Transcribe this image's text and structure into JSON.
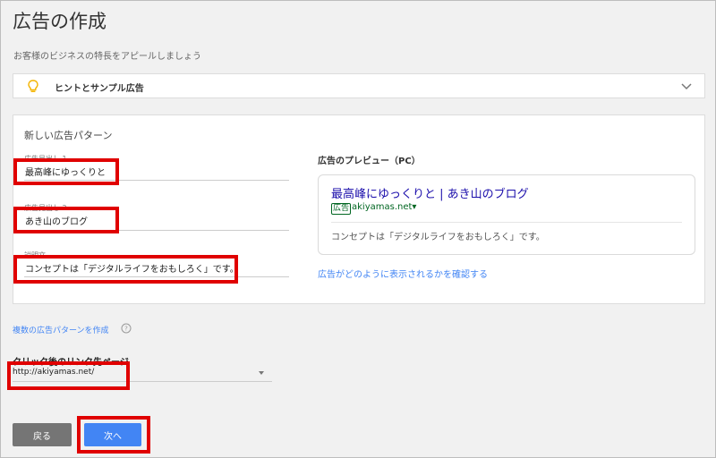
{
  "page": {
    "title": "広告の作成",
    "subtitle": "お客様のビジネスの特長をアピールしましょう"
  },
  "hints": {
    "label": "ヒントとサンプル広告",
    "icon": "lightbulb-icon",
    "toggle_icon": "chevron-down-icon"
  },
  "pattern": {
    "title": "新しい広告パターン",
    "headline1": {
      "label": "広告見出し 1",
      "value": "最高峰にゆっくりと"
    },
    "headline2": {
      "label": "広告見出し 2",
      "value": "あき山のブログ"
    },
    "description": {
      "label": "説明文",
      "value": "コンセプトは「デジタルライフをおもしろく」です。"
    }
  },
  "preview": {
    "title": "広告のプレビュー（PC）",
    "headline": "最高峰にゆっくりと | あき山のブログ",
    "ad_badge": "広告",
    "url": "akiyamas.net",
    "url_dropdown_icon": "▾",
    "description": "コンセプトは「デジタルライフをおもしろく」です。",
    "link": "広告がどのように表示されるかを確認する"
  },
  "multi_pattern": {
    "link": "複数の広告パターンを作成",
    "help_icon": "help-circle-icon"
  },
  "landing": {
    "label": "クリック後のリンク先ページ",
    "value": "http://akiyamas.net/"
  },
  "buttons": {
    "back": "戻る",
    "next": "次へ"
  },
  "colors": {
    "accent": "#4285f4",
    "annotation_red": "#e00000",
    "ad_green": "#006621",
    "headline_blue": "#1a0dab"
  }
}
